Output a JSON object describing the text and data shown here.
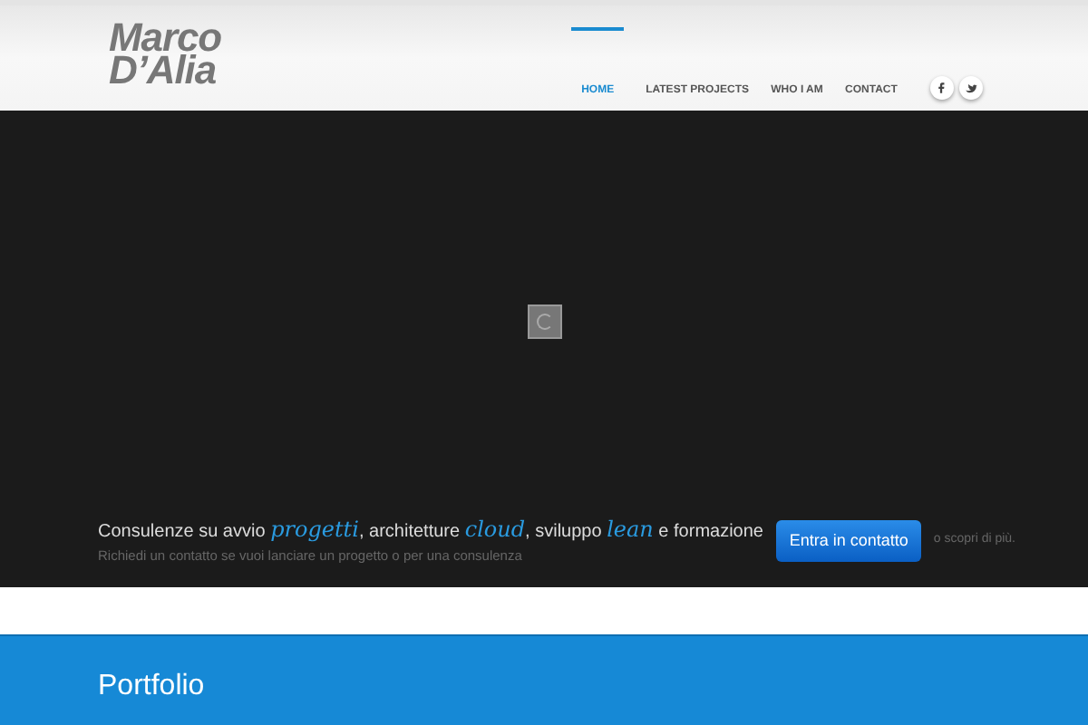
{
  "logo": {
    "line1": "Marco",
    "line2": "D’Alia"
  },
  "nav": [
    {
      "label": "HOME",
      "selected": true
    },
    {
      "label": "LATEST PROJECTS",
      "selected": false
    },
    {
      "label": "WHO I AM",
      "selected": false
    },
    {
      "label": "CONTACT",
      "selected": false
    }
  ],
  "social": [
    {
      "kind": "facebook"
    },
    {
      "kind": "twitter"
    }
  ],
  "hero": {
    "tagline": [
      {
        "text": "Consulenze su avvio ",
        "accent": false
      },
      {
        "text": "progetti",
        "accent": true
      },
      {
        "text": ", architetture ",
        "accent": false
      },
      {
        "text": "cloud",
        "accent": true
      },
      {
        "text": ", sviluppo ",
        "accent": false
      },
      {
        "text": "lean",
        "accent": true
      },
      {
        "text": " e formazione",
        "accent": false
      }
    ],
    "subtitle": "Richiedi un contatto se vuoi lanciare un progetto o per una consulenza",
    "button": "Entra in contatto",
    "aside": "o scopri di più."
  },
  "section": {
    "title": "Portfolio"
  }
}
